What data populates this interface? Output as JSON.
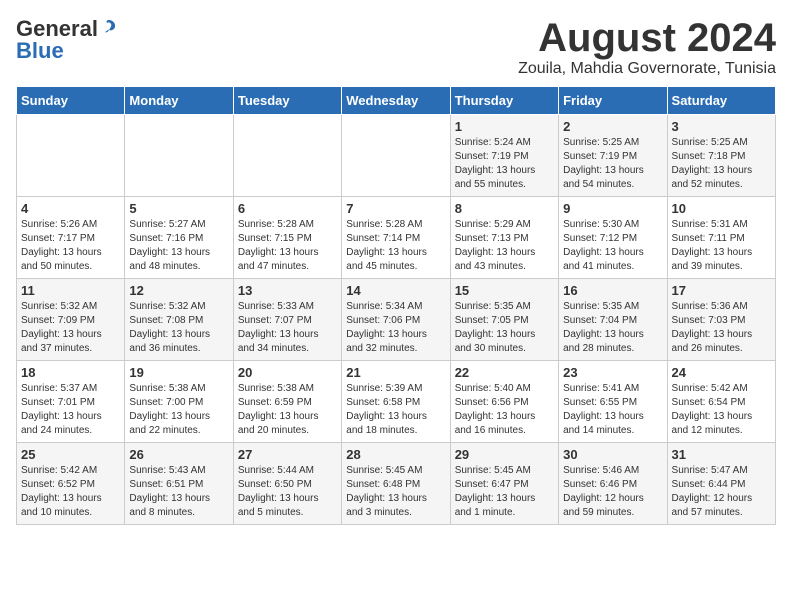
{
  "header": {
    "logo_general": "General",
    "logo_blue": "Blue",
    "month": "August 2024",
    "location": "Zouila, Mahdia Governorate, Tunisia"
  },
  "days_of_week": [
    "Sunday",
    "Monday",
    "Tuesday",
    "Wednesday",
    "Thursday",
    "Friday",
    "Saturday"
  ],
  "weeks": [
    [
      {
        "num": "",
        "info": ""
      },
      {
        "num": "",
        "info": ""
      },
      {
        "num": "",
        "info": ""
      },
      {
        "num": "",
        "info": ""
      },
      {
        "num": "1",
        "info": "Sunrise: 5:24 AM\nSunset: 7:19 PM\nDaylight: 13 hours\nand 55 minutes."
      },
      {
        "num": "2",
        "info": "Sunrise: 5:25 AM\nSunset: 7:19 PM\nDaylight: 13 hours\nand 54 minutes."
      },
      {
        "num": "3",
        "info": "Sunrise: 5:25 AM\nSunset: 7:18 PM\nDaylight: 13 hours\nand 52 minutes."
      }
    ],
    [
      {
        "num": "4",
        "info": "Sunrise: 5:26 AM\nSunset: 7:17 PM\nDaylight: 13 hours\nand 50 minutes."
      },
      {
        "num": "5",
        "info": "Sunrise: 5:27 AM\nSunset: 7:16 PM\nDaylight: 13 hours\nand 48 minutes."
      },
      {
        "num": "6",
        "info": "Sunrise: 5:28 AM\nSunset: 7:15 PM\nDaylight: 13 hours\nand 47 minutes."
      },
      {
        "num": "7",
        "info": "Sunrise: 5:28 AM\nSunset: 7:14 PM\nDaylight: 13 hours\nand 45 minutes."
      },
      {
        "num": "8",
        "info": "Sunrise: 5:29 AM\nSunset: 7:13 PM\nDaylight: 13 hours\nand 43 minutes."
      },
      {
        "num": "9",
        "info": "Sunrise: 5:30 AM\nSunset: 7:12 PM\nDaylight: 13 hours\nand 41 minutes."
      },
      {
        "num": "10",
        "info": "Sunrise: 5:31 AM\nSunset: 7:11 PM\nDaylight: 13 hours\nand 39 minutes."
      }
    ],
    [
      {
        "num": "11",
        "info": "Sunrise: 5:32 AM\nSunset: 7:09 PM\nDaylight: 13 hours\nand 37 minutes."
      },
      {
        "num": "12",
        "info": "Sunrise: 5:32 AM\nSunset: 7:08 PM\nDaylight: 13 hours\nand 36 minutes."
      },
      {
        "num": "13",
        "info": "Sunrise: 5:33 AM\nSunset: 7:07 PM\nDaylight: 13 hours\nand 34 minutes."
      },
      {
        "num": "14",
        "info": "Sunrise: 5:34 AM\nSunset: 7:06 PM\nDaylight: 13 hours\nand 32 minutes."
      },
      {
        "num": "15",
        "info": "Sunrise: 5:35 AM\nSunset: 7:05 PM\nDaylight: 13 hours\nand 30 minutes."
      },
      {
        "num": "16",
        "info": "Sunrise: 5:35 AM\nSunset: 7:04 PM\nDaylight: 13 hours\nand 28 minutes."
      },
      {
        "num": "17",
        "info": "Sunrise: 5:36 AM\nSunset: 7:03 PM\nDaylight: 13 hours\nand 26 minutes."
      }
    ],
    [
      {
        "num": "18",
        "info": "Sunrise: 5:37 AM\nSunset: 7:01 PM\nDaylight: 13 hours\nand 24 minutes."
      },
      {
        "num": "19",
        "info": "Sunrise: 5:38 AM\nSunset: 7:00 PM\nDaylight: 13 hours\nand 22 minutes."
      },
      {
        "num": "20",
        "info": "Sunrise: 5:38 AM\nSunset: 6:59 PM\nDaylight: 13 hours\nand 20 minutes."
      },
      {
        "num": "21",
        "info": "Sunrise: 5:39 AM\nSunset: 6:58 PM\nDaylight: 13 hours\nand 18 minutes."
      },
      {
        "num": "22",
        "info": "Sunrise: 5:40 AM\nSunset: 6:56 PM\nDaylight: 13 hours\nand 16 minutes."
      },
      {
        "num": "23",
        "info": "Sunrise: 5:41 AM\nSunset: 6:55 PM\nDaylight: 13 hours\nand 14 minutes."
      },
      {
        "num": "24",
        "info": "Sunrise: 5:42 AM\nSunset: 6:54 PM\nDaylight: 13 hours\nand 12 minutes."
      }
    ],
    [
      {
        "num": "25",
        "info": "Sunrise: 5:42 AM\nSunset: 6:52 PM\nDaylight: 13 hours\nand 10 minutes."
      },
      {
        "num": "26",
        "info": "Sunrise: 5:43 AM\nSunset: 6:51 PM\nDaylight: 13 hours\nand 8 minutes."
      },
      {
        "num": "27",
        "info": "Sunrise: 5:44 AM\nSunset: 6:50 PM\nDaylight: 13 hours\nand 5 minutes."
      },
      {
        "num": "28",
        "info": "Sunrise: 5:45 AM\nSunset: 6:48 PM\nDaylight: 13 hours\nand 3 minutes."
      },
      {
        "num": "29",
        "info": "Sunrise: 5:45 AM\nSunset: 6:47 PM\nDaylight: 13 hours\nand 1 minute."
      },
      {
        "num": "30",
        "info": "Sunrise: 5:46 AM\nSunset: 6:46 PM\nDaylight: 12 hours\nand 59 minutes."
      },
      {
        "num": "31",
        "info": "Sunrise: 5:47 AM\nSunset: 6:44 PM\nDaylight: 12 hours\nand 57 minutes."
      }
    ]
  ]
}
